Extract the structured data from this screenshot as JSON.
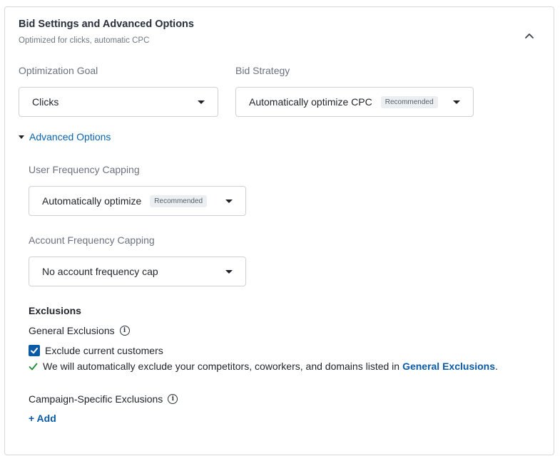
{
  "header": {
    "title": "Bid Settings and Advanced Options",
    "subtitle": "Optimized for clicks, automatic CPC"
  },
  "optimization_goal": {
    "label": "Optimization Goal",
    "value": "Clicks"
  },
  "bid_strategy": {
    "label": "Bid Strategy",
    "value": "Automatically optimize CPC",
    "badge": "Recommended"
  },
  "advanced_options": {
    "toggle_label": "Advanced Options",
    "user_frequency": {
      "label": "User Frequency Capping",
      "value": "Automatically optimize",
      "badge": "Recommended"
    },
    "account_frequency": {
      "label": "Account Frequency Capping",
      "value": "No account frequency cap"
    }
  },
  "exclusions": {
    "heading": "Exclusions",
    "general_label": "General Exclusions",
    "exclude_current_customers": {
      "label": "Exclude current customers",
      "checked": true
    },
    "auto_note": "We will automatically exclude your competitors, coworkers, and domains listed in",
    "auto_note_link": "General Exclusions",
    "auto_note_end": ".",
    "campaign_label": "Campaign-Specific Exclusions",
    "add_label": "+ Add"
  },
  "colors": {
    "link": "#0a5aa8",
    "checkbox": "#0a5aa8",
    "success_check": "#1e8a3c"
  },
  "icons": [
    "chevron-up-icon",
    "caret-down-icon",
    "info-icon",
    "checkmark-icon"
  ]
}
